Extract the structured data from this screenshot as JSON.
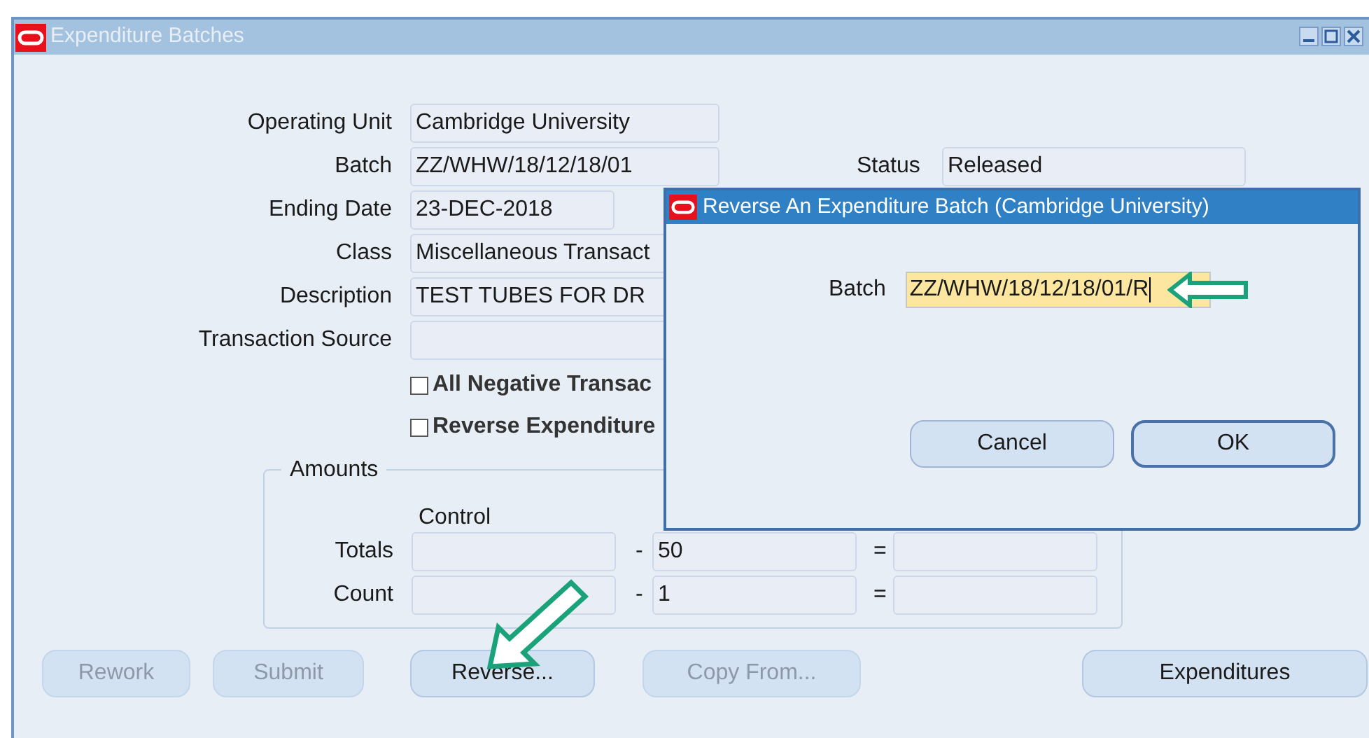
{
  "window": {
    "title": "Expenditure Batches"
  },
  "form": {
    "fields": [
      {
        "label": "Operating Unit",
        "value": "Cambridge University",
        "kind": "wide"
      },
      {
        "label": "Batch",
        "value": "ZZ/WHW/18/12/18/01",
        "kind": "wide",
        "side_label": "Status",
        "side_value": "Released"
      },
      {
        "label": "Ending Date",
        "value": "23-DEC-2018",
        "kind": "short"
      },
      {
        "label": "Class",
        "value": "Miscellaneous Transact",
        "kind": "wide"
      },
      {
        "label": "Description",
        "value": "TEST TUBES FOR DR",
        "kind": "wide"
      },
      {
        "label": "Transaction Source",
        "kind": "wide"
      }
    ],
    "checkboxes": [
      {
        "label": "All Negative Transac",
        "checked": false
      },
      {
        "label": "Reverse Expenditure",
        "checked": false
      }
    ]
  },
  "amounts": {
    "title": "Amounts",
    "column_1": "Control",
    "rows": [
      {
        "label": "Totals",
        "minus": "-",
        "value": "50",
        "equals": "="
      },
      {
        "label": "Count",
        "minus": "-",
        "value": "1",
        "equals": "="
      }
    ]
  },
  "buttons": [
    {
      "label": "Rework",
      "disabled": true
    },
    {
      "label": "Submit",
      "disabled": true
    },
    {
      "label": "Reverse...",
      "disabled": false
    },
    {
      "label": "Copy From...",
      "disabled": true
    },
    {
      "label": "Expenditures",
      "disabled": false
    }
  ],
  "dialog": {
    "title": "Reverse An Expenditure Batch (Cambridge University)",
    "batch_label": "Batch",
    "batch_value": "ZZ/WHW/18/12/18/01/R",
    "buttons": [
      {
        "label": "Cancel",
        "default": false
      },
      {
        "label": "OK",
        "default": true
      }
    ]
  }
}
